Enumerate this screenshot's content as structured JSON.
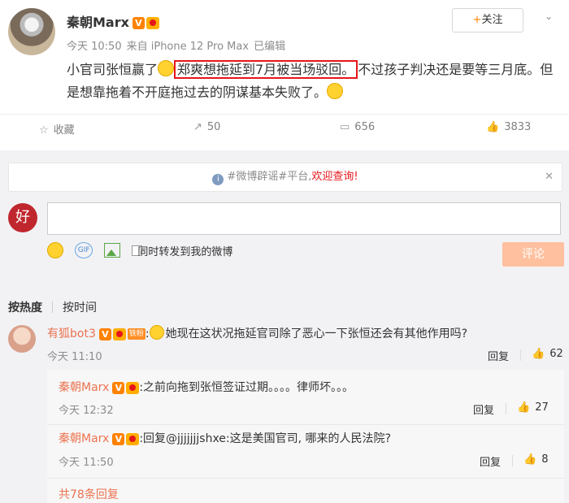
{
  "post": {
    "username": "秦朝Marx",
    "v_badge": "V",
    "time": "今天 10:50",
    "source": "来自 iPhone 12 Pro Max",
    "edited": "已编辑",
    "follow_icon": "+",
    "follow_label": "关注",
    "text_before": "小官司张恒赢了",
    "text_highlight": "郑爽想拖延到7月被当场驳回。",
    "text_after": "不过孩子判决还是要等三月底。但是想靠拖着不开庭拖过去的阴谋基本失败了。"
  },
  "actions": {
    "favorite_label": "收藏",
    "repost_count": "50",
    "comment_count": "656",
    "like_count": "3833"
  },
  "notice": {
    "text": "#微博辟谣#平台,",
    "highlight": "欢迎查询!"
  },
  "composer": {
    "avatar_text": "好",
    "checkbox_label": "同时转发到我的微博",
    "submit_label": "评论",
    "gif_label": "GIF"
  },
  "sort": {
    "hot": "按热度",
    "time": "按时间"
  },
  "comments": [
    {
      "user": "有狐bot3",
      "tag": "铁粉",
      "text": "她现在这状况拖延官司除了恶心一下张恒还会有其他作用吗?",
      "time": "今天 11:10",
      "reply": "回复",
      "likes": "62"
    }
  ],
  "replies": [
    {
      "user": "秦朝Marx",
      "text": ":之前向拖到张恒签证过期。。。。律师坏。。。",
      "time": "今天 12:32",
      "reply": "回复",
      "likes": "27"
    },
    {
      "user": "秦朝Marx",
      "text": ":回复@jjjjjjjshxe:这是美国官司, 哪来的人民法院?",
      "time": "今天 11:50",
      "reply": "回复",
      "likes": "8"
    }
  ],
  "more_replies": "共78条回复",
  "colors": {
    "accent": "#ff8200",
    "username": "#eb7350",
    "highlight_border": "#e5161a",
    "submit_disabled": "#ffc09f"
  }
}
